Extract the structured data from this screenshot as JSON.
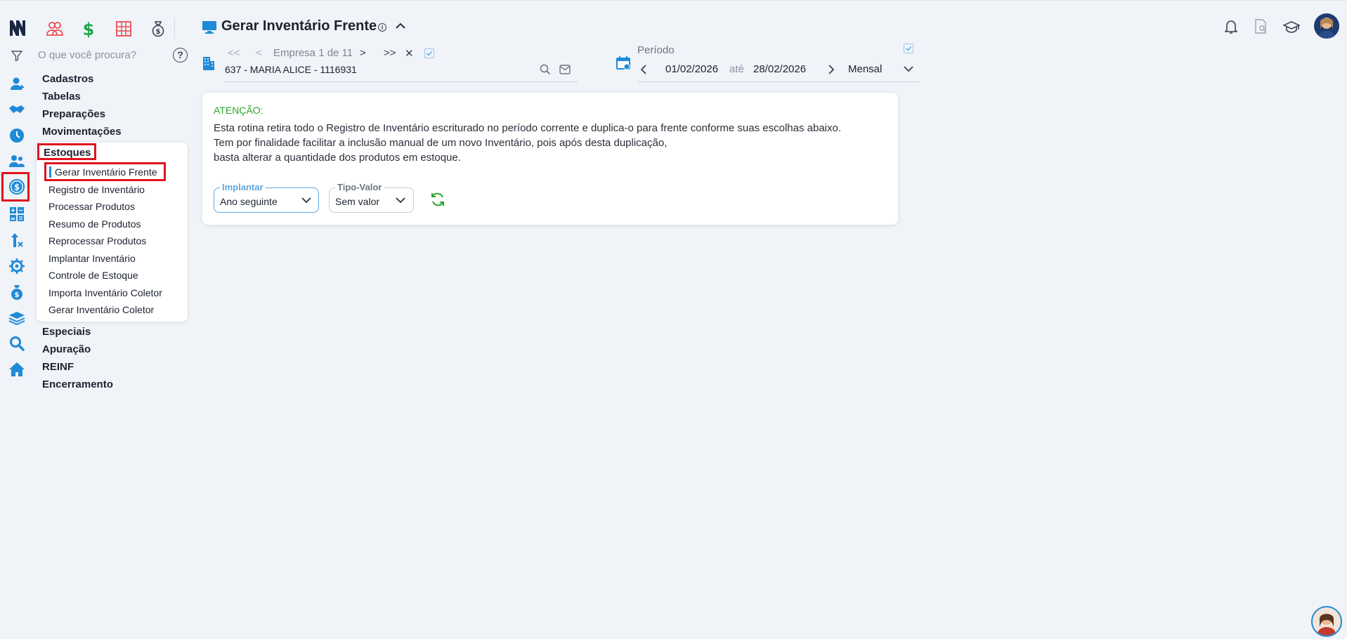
{
  "header": {
    "title": "Gerar Inventário Frente"
  },
  "search": {
    "placeholder": "O que você procura?"
  },
  "top_modules": [
    "people-group-icon",
    "dollar-icon",
    "grid-table-icon",
    "money-bag-icon"
  ],
  "rail_icons": [
    "user-icon",
    "handshake-icon",
    "clock-icon",
    "users-icon",
    "dollar-circle-icon",
    "calculator-icon",
    "tools-icon",
    "gear-network-icon",
    "money-bag-icon",
    "layers-icon",
    "magnifier-icon",
    "home-icon"
  ],
  "menu": {
    "items_top": [
      "Cadastros",
      "Tabelas",
      "Preparações",
      "Movimentações"
    ],
    "active_group": "Estoques",
    "sub_items": [
      "Gerar Inventário Frente",
      "Registro de Inventário",
      "Processar Produtos",
      "Resumo de Produtos",
      "Reprocessar Produtos",
      "Implantar Inventário",
      "Controle de Estoque",
      "Importa Inventário Coletor",
      "Gerar Inventário Coletor"
    ],
    "items_bottom": [
      "Especiais",
      "Apuração",
      "REINF",
      "Encerramento"
    ]
  },
  "company_nav": {
    "first": "<<",
    "prev": "<",
    "label": "Empresa 1 de 11",
    "next": ">",
    "last": ">>",
    "close": "✕",
    "company": "637 - MARIA ALICE - 1116931"
  },
  "period": {
    "label": "Período",
    "start": "01/02/2026",
    "sep": "até",
    "end": "28/02/2026",
    "mode": "Mensal"
  },
  "notice": {
    "title": "ATENÇÃO:",
    "line1": "Esta rotina retira todo o Registro de Inventário escriturado no período corrente e duplica-o para frente conforme suas escolhas abaixo.",
    "line2": "Tem por finalidade facilitar a inclusão manual de um novo Inventário, pois após desta duplicação,",
    "line3": "basta alterar a quantidade dos produtos em estoque."
  },
  "form": {
    "implantar_label": "Implantar",
    "implantar_value": "Ano seguinte",
    "tipo_label": "Tipo-Valor",
    "tipo_value": "Sem valor"
  },
  "colors": {
    "accent": "#1f8ad8",
    "highlight": "#e0141e",
    "success": "#2aa52f"
  }
}
